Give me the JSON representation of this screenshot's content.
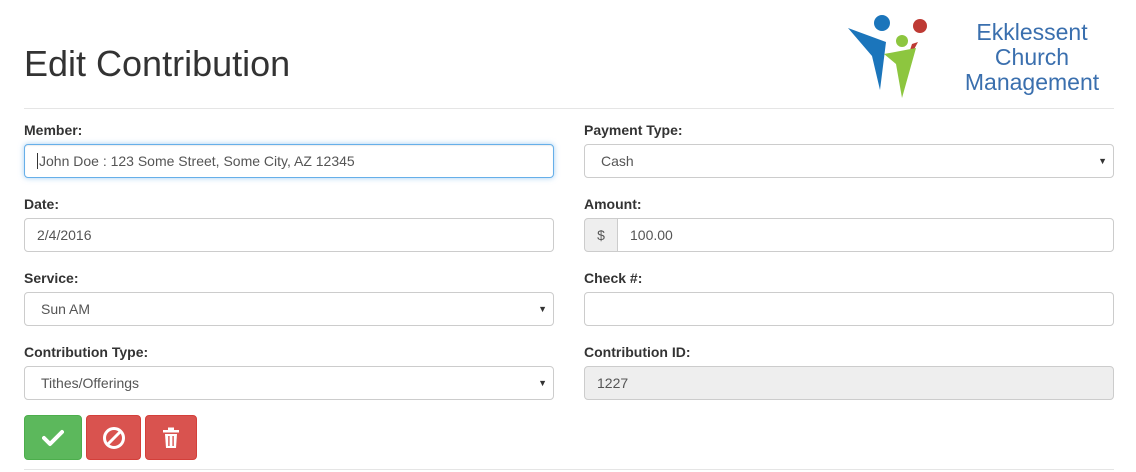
{
  "page": {
    "title": "Edit Contribution"
  },
  "logo": {
    "line1": "Ekklessent",
    "line2": "Church",
    "line3": "Management"
  },
  "form": {
    "member": {
      "label": "Member:",
      "value": "John Doe : 123 Some Street, Some City, AZ 12345"
    },
    "payment_type": {
      "label": "Payment Type:",
      "value": "Cash"
    },
    "date": {
      "label": "Date:",
      "value": "2/4/2016"
    },
    "amount": {
      "label": "Amount:",
      "prefix": "$",
      "value": "100.00"
    },
    "service": {
      "label": "Service:",
      "value": "Sun AM"
    },
    "check_number": {
      "label": "Check #:",
      "value": ""
    },
    "contribution_type": {
      "label": "Contribution Type:",
      "value": "Tithes/Offerings"
    },
    "contribution_id": {
      "label": "Contribution ID:",
      "value": "1227"
    }
  },
  "actions": {
    "save_icon": "check-icon",
    "cancel_icon": "ban-icon",
    "delete_icon": "trash-icon"
  },
  "colors": {
    "success": "#5cb85c",
    "danger": "#d9534f",
    "logo_text": "#3a6fae",
    "logo_blue": "#1b75bb",
    "logo_red": "#be3a34",
    "logo_green": "#8dc63f"
  }
}
